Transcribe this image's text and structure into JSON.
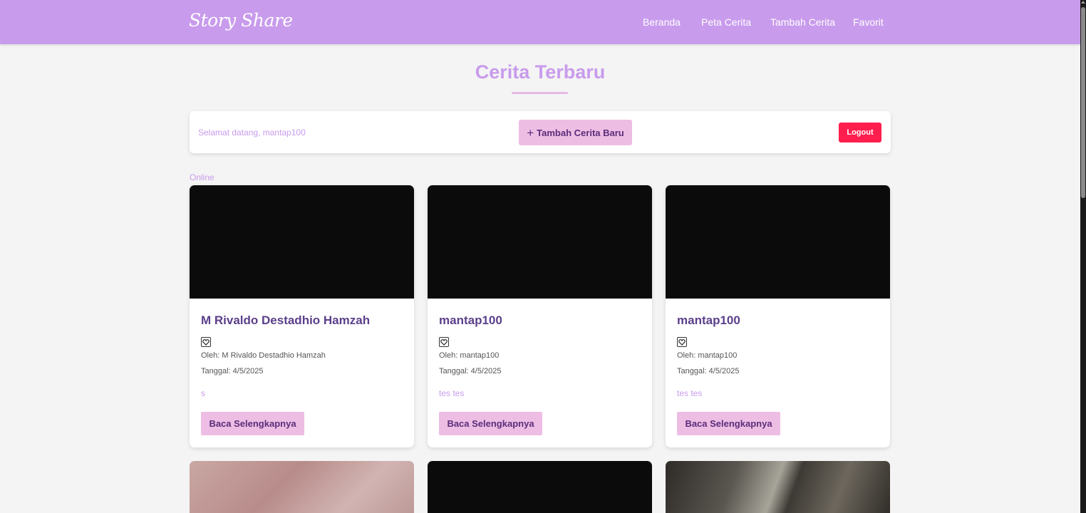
{
  "app": {
    "brand": "Story Share"
  },
  "nav": [
    {
      "label": "Beranda"
    },
    {
      "label": "Peta Cerita"
    },
    {
      "label": "Tambah Cerita"
    },
    {
      "label": "Favorit"
    }
  ],
  "page": {
    "title": "Cerita Terbaru"
  },
  "welcome": {
    "text": "Selamat datang, mantap100",
    "add_button": "Tambah Cerita Baru",
    "add_icon": "plus-icon",
    "logout": "Logout"
  },
  "status": "Online",
  "stories": [
    {
      "title": "M Rivaldo Destadhio Hamzah",
      "author": "Oleh: M Rivaldo Destadhio Hamzah",
      "date": "Tanggal: 4/5/2025",
      "description": "s",
      "button": "Baca Selengkapnya",
      "icon": "heart-icon"
    },
    {
      "title": "mantap100",
      "author": "Oleh: mantap100",
      "date": "Tanggal: 4/5/2025",
      "description": "tes tes",
      "button": "Baca Selengkapnya",
      "icon": "heart-icon"
    },
    {
      "title": "mantap100",
      "author": "Oleh: mantap100",
      "date": "Tanggal: 4/5/2025",
      "description": "tes tes",
      "button": "Baca Selengkapnya",
      "icon": "heart-icon"
    }
  ],
  "colors": {
    "navbar": "#c89bec",
    "accent": "#c89bec",
    "button": "#eebde4",
    "logout": "#ff1e4d",
    "card_title": "#5b3f8a"
  }
}
